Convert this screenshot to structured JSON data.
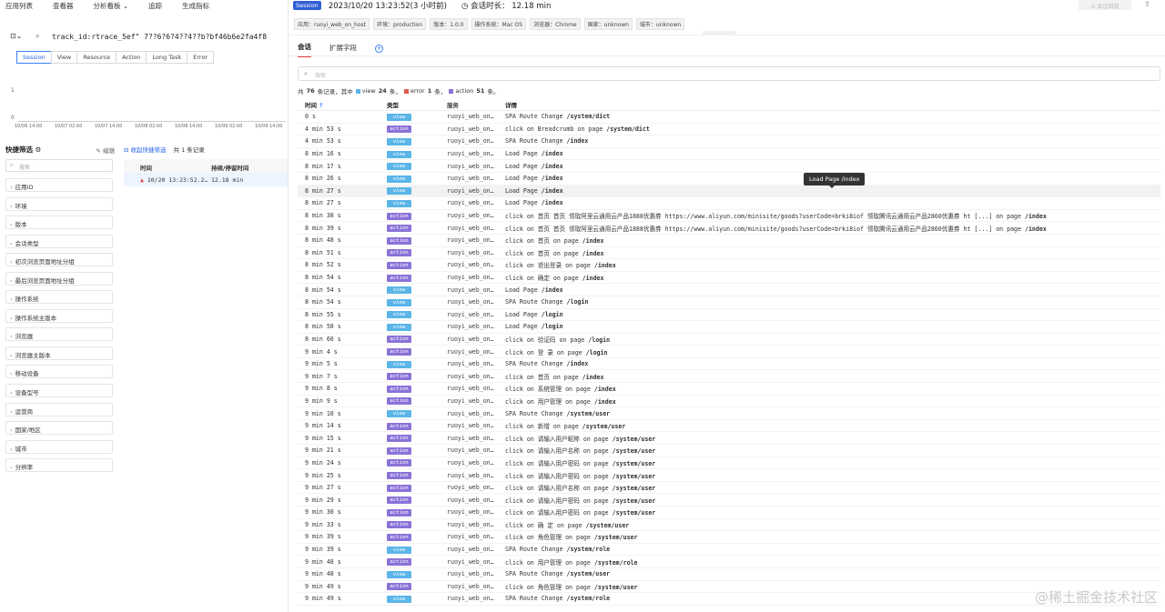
{
  "left": {
    "nav": [
      "应用列表",
      "查看器",
      "分析看板 ⌄",
      "追踪",
      "生成指标"
    ],
    "search_query": "track_id:rtrace_5ef\" 7??6?6?4??4??b?bf46b6e2fa4f8",
    "subtabs": [
      "Session",
      "View",
      "Resource",
      "Action",
      "Long Task",
      "Error"
    ],
    "chart": {
      "yticks": [
        "1",
        "0"
      ],
      "xticks": [
        "10/06 14:00",
        "10/07 02:00",
        "10/07 14:00",
        "10/08 02:00",
        "10/08 14:00",
        "10/09 02:00",
        "10/09 14:00"
      ]
    },
    "quick_filter_title": "快捷筛选",
    "edit_label": "编辑",
    "filter_search_placeholder": "搜索",
    "filters": [
      "应用ID",
      "环境",
      "版本",
      "会话类型",
      "初次浏览页面地址分组",
      "最后浏览页面地址分组",
      "操作系统",
      "操作系统主版本",
      "浏览器",
      "浏览器主版本",
      "移动设备",
      "设备型号",
      "运营商",
      "国家/地区",
      "城市",
      "分辨率"
    ],
    "collapse_label": "收起快捷筛选",
    "count_label": "共 1 条记录",
    "table_headers": [
      "时间",
      "持续/停留时间"
    ],
    "table_row": {
      "time": "10/20 13:23:52.2…",
      "duration": "12.18 min"
    }
  },
  "drawer": {
    "badge": "Session",
    "datetime": "2023/10/20 13:23:52(3 小时前)",
    "duration": "会话时长： 12.18 min",
    "share_label": "会话回放",
    "tags": [
      "应用：ruoyi_web_on_host",
      "环境：production",
      "版本：1.0.0",
      "操作系统：Mac OS",
      "浏览器：Chrome",
      "国家：unknown",
      "城市：unknown"
    ],
    "tabs": [
      "会话",
      "扩展字段"
    ],
    "search_placeholder": "搜索",
    "summary": {
      "prefix": "共",
      "total": "76",
      "mid": "条记录，其中",
      "view_label": "view",
      "view_count": "24",
      "error_label": "error",
      "error_count": "1",
      "action_label": "action",
      "action_count": "51",
      "unit": "条",
      "colors": {
        "view": "#5ab5e8",
        "error": "#e05a4f",
        "action": "#8a72d8"
      }
    },
    "headers": [
      "时间",
      "类型",
      "服务",
      "详情"
    ],
    "tooltip": "Load Page /index",
    "rows": [
      {
        "t": "0 s",
        "type": "view",
        "svc": "ruoyi_web_on…",
        "d": "SPA Route Change",
        "p": "/system/dict"
      },
      {
        "t": "4 min 53 s",
        "type": "action",
        "svc": "ruoyi_web_on…",
        "d": "click on Breadcrumb on page",
        "p": "/system/dict"
      },
      {
        "t": "4 min 53 s",
        "type": "view",
        "svc": "ruoyi_web_on…",
        "d": "SPA Route Change",
        "p": "/index"
      },
      {
        "t": "8 min 16 s",
        "type": "view",
        "svc": "ruoyi_web_on…",
        "d": "Load Page",
        "p": "/index"
      },
      {
        "t": "8 min 17 s",
        "type": "view",
        "svc": "ruoyi_web_on…",
        "d": "Load Page",
        "p": "/index"
      },
      {
        "t": "8 min 26 s",
        "type": "view",
        "svc": "ruoyi_web_on…",
        "d": "Load Page",
        "p": "/index"
      },
      {
        "t": "8 min 27 s",
        "type": "view",
        "svc": "ruoyi_web_on…",
        "d": "Load Page",
        "p": "/index"
      },
      {
        "t": "8 min 27 s",
        "type": "view",
        "svc": "ruoyi_web_on…",
        "d": "Load Page",
        "p": "/index"
      },
      {
        "t": "8 min 38 s",
        "type": "action",
        "svc": "ruoyi_web_on…",
        "d": "click on 首页 首页 领取阿里云通用云产品1888优惠券 https://www.aliyun.com/minisite/goods?userCode=brki8iof 领取腾讯云通用云产品2860优惠券 ht [...] on page",
        "p": "/index"
      },
      {
        "t": "8 min 39 s",
        "type": "action",
        "svc": "ruoyi_web_on…",
        "d": "click on 首页 首页 领取阿里云通用云产品1888优惠券 https://www.aliyun.com/minisite/goods?userCode=brki8iof 领取腾讯云通用云产品2860优惠券 ht [...] on page",
        "p": "/index"
      },
      {
        "t": "8 min 48 s",
        "type": "action",
        "svc": "ruoyi_web_on…",
        "d": "click on 首页 on page",
        "p": "/index"
      },
      {
        "t": "8 min 51 s",
        "type": "action",
        "svc": "ruoyi_web_on…",
        "d": "click on 首页 on page",
        "p": "/index"
      },
      {
        "t": "8 min 52 s",
        "type": "action",
        "svc": "ruoyi_web_on…",
        "d": "click on 退出登录 on page",
        "p": "/index"
      },
      {
        "t": "8 min 54 s",
        "type": "action",
        "svc": "ruoyi_web_on…",
        "d": "click on 确定 on page",
        "p": "/index"
      },
      {
        "t": "8 min 54 s",
        "type": "view",
        "svc": "ruoyi_web_on…",
        "d": "Load Page",
        "p": "/index"
      },
      {
        "t": "8 min 54 s",
        "type": "view",
        "svc": "ruoyi_web_on…",
        "d": "SPA Route Change",
        "p": "/login"
      },
      {
        "t": "8 min 55 s",
        "type": "view",
        "svc": "ruoyi_web_on…",
        "d": "Load Page",
        "p": "/login"
      },
      {
        "t": "8 min 58 s",
        "type": "view",
        "svc": "ruoyi_web_on…",
        "d": "Load Page",
        "p": "/login"
      },
      {
        "t": "8 min 60 s",
        "type": "action",
        "svc": "ruoyi_web_on…",
        "d": "click on 验证码 on page",
        "p": "/login"
      },
      {
        "t": "9 min 4 s",
        "type": "action",
        "svc": "ruoyi_web_on…",
        "d": "click on 登 录 on page",
        "p": "/login"
      },
      {
        "t": "9 min 5 s",
        "type": "view",
        "svc": "ruoyi_web_on…",
        "d": "SPA Route Change",
        "p": "/index"
      },
      {
        "t": "9 min 7 s",
        "type": "action",
        "svc": "ruoyi_web_on…",
        "d": "click on 首页 on page",
        "p": "/index"
      },
      {
        "t": "9 min 8 s",
        "type": "action",
        "svc": "ruoyi_web_on…",
        "d": "click on 系统管理 on page",
        "p": "/index"
      },
      {
        "t": "9 min 9 s",
        "type": "action",
        "svc": "ruoyi_web_on…",
        "d": "click on 用户管理 on page",
        "p": "/index"
      },
      {
        "t": "9 min 10 s",
        "type": "view",
        "svc": "ruoyi_web_on…",
        "d": "SPA Route Change",
        "p": "/system/user"
      },
      {
        "t": "9 min 14 s",
        "type": "action",
        "svc": "ruoyi_web_on…",
        "d": "click on 新增 on page",
        "p": "/system/user"
      },
      {
        "t": "9 min 15 s",
        "type": "action",
        "svc": "ruoyi_web_on…",
        "d": "click on 请输入用户昵称 on page",
        "p": "/system/user"
      },
      {
        "t": "9 min 21 s",
        "type": "action",
        "svc": "ruoyi_web_on…",
        "d": "click on 请输入用户名称 on page",
        "p": "/system/user"
      },
      {
        "t": "9 min 24 s",
        "type": "action",
        "svc": "ruoyi_web_on…",
        "d": "click on 请输入用户密码 on page",
        "p": "/system/user"
      },
      {
        "t": "9 min 25 s",
        "type": "action",
        "svc": "ruoyi_web_on…",
        "d": "click on 请输入用户密码 on page",
        "p": "/system/user"
      },
      {
        "t": "9 min 27 s",
        "type": "action",
        "svc": "ruoyi_web_on…",
        "d": "click on 请输入用户名称 on page",
        "p": "/system/user"
      },
      {
        "t": "9 min 29 s",
        "type": "action",
        "svc": "ruoyi_web_on…",
        "d": "click on 请输入用户密码 on page",
        "p": "/system/user"
      },
      {
        "t": "9 min 30 s",
        "type": "action",
        "svc": "ruoyi_web_on…",
        "d": "click on 请输入用户密码 on page",
        "p": "/system/user"
      },
      {
        "t": "9 min 33 s",
        "type": "action",
        "svc": "ruoyi_web_on…",
        "d": "click on 确 定 on page",
        "p": "/system/user"
      },
      {
        "t": "9 min 39 s",
        "type": "action",
        "svc": "ruoyi_web_on…",
        "d": "click on 角色管理 on page",
        "p": "/system/user"
      },
      {
        "t": "9 min 39 s",
        "type": "view",
        "svc": "ruoyi_web_on…",
        "d": "SPA Route Change",
        "p": "/system/role"
      },
      {
        "t": "9 min 48 s",
        "type": "action",
        "svc": "ruoyi_web_on…",
        "d": "click on 用户管理 on page",
        "p": "/system/role"
      },
      {
        "t": "9 min 48 s",
        "type": "view",
        "svc": "ruoyi_web_on…",
        "d": "SPA Route Change",
        "p": "/system/user"
      },
      {
        "t": "9 min 49 s",
        "type": "action",
        "svc": "ruoyi_web_on…",
        "d": "click on 角色管理 on page",
        "p": "/system/user"
      },
      {
        "t": "9 min 49 s",
        "type": "view",
        "svc": "ruoyi_web_on…",
        "d": "SPA Route Change",
        "p": "/system/role"
      }
    ]
  },
  "watermark": "@稀土掘金技术社区"
}
